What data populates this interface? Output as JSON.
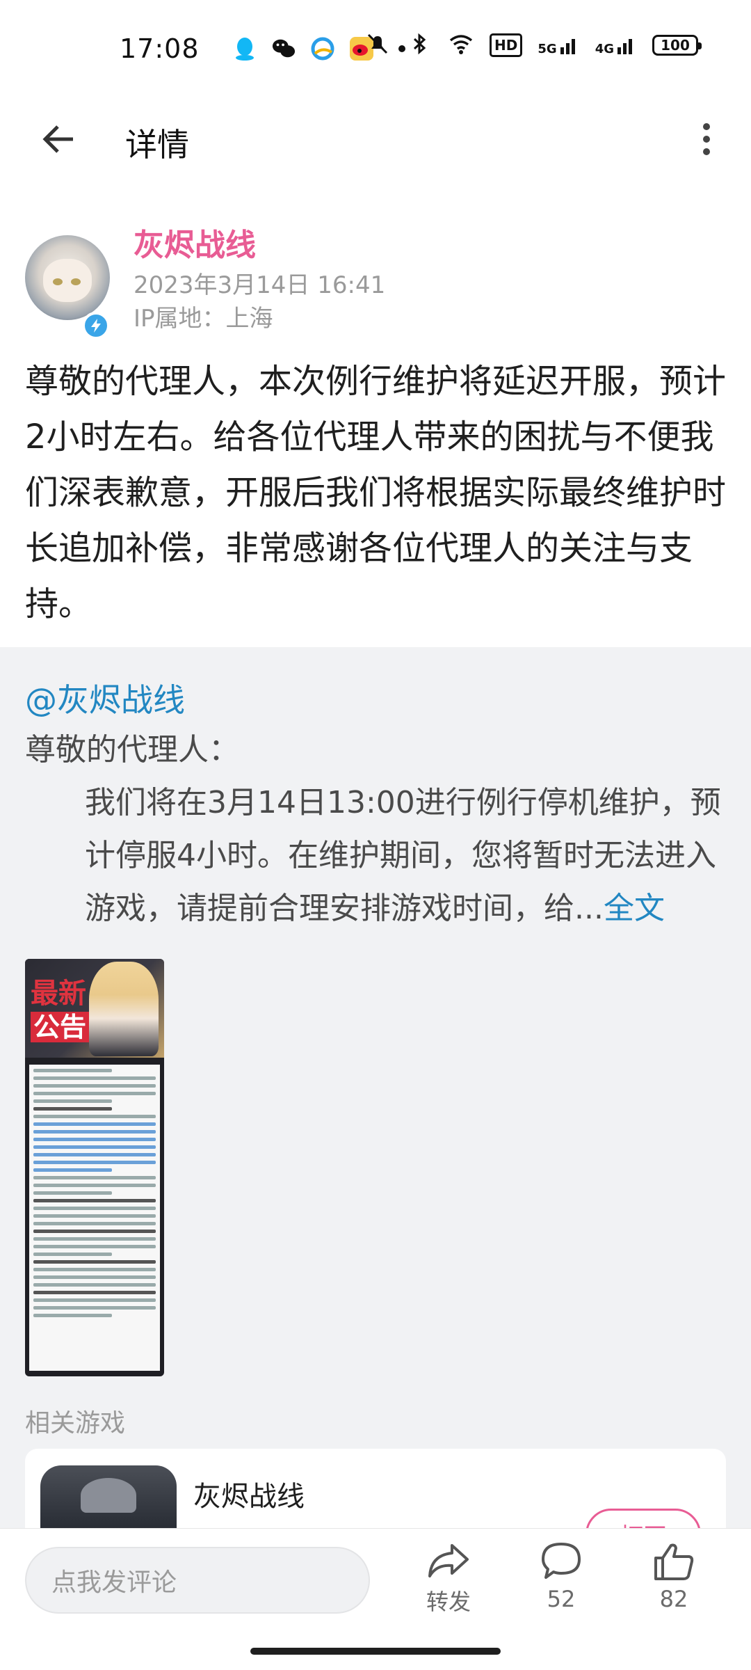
{
  "status_bar": {
    "time": "17:08",
    "hd_badge": "HD",
    "net_5g": "5G",
    "net_4g": "4G",
    "battery": "100"
  },
  "header": {
    "title": "详情"
  },
  "post": {
    "author": "灰烬战线",
    "time": "2023年3月14日 16:41",
    "ip_location": "IP属地：上海",
    "body": "尊敬的代理人，本次例行维护将延迟开服，预计2小时左右。给各位代理人带来的困扰与不便我们深表歉意，开服后我们将根据实际最终维护时长追加补偿，非常感谢各位代理人的关注与支持。"
  },
  "repost": {
    "user": "@灰烬战线",
    "line1": "尊敬的代理人：",
    "line2": "我们将在3月14日13:00进行例行停机维护，预计停服4小时。在维护期间，您将暂时无法进入游戏，请提前合理安排游戏时间，给...",
    "fulltext_link": "全文",
    "image_tag1": "最新",
    "image_tag2": "公告"
  },
  "related": {
    "label": "相关游戏",
    "game_name": "灰烬战线",
    "open_button": "打开"
  },
  "bottom_bar": {
    "comment_placeholder": "点我发评论",
    "repost_label": "转发",
    "comment_count": "52",
    "like_count": "82"
  },
  "colors": {
    "brand_pink": "#e85c94",
    "link_blue": "#2287c2",
    "repost_bg": "#f1f2f4"
  }
}
